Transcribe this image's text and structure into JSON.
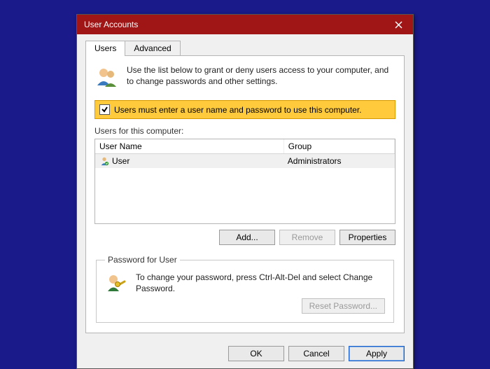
{
  "window": {
    "title": "User Accounts"
  },
  "tabs": {
    "users": "Users",
    "advanced": "Advanced"
  },
  "intro": "Use the list below to grant or deny users access to your computer, and to change passwords and other settings.",
  "checkbox_label": "Users must enter a user name and password to use this computer.",
  "list_label": "Users for this computer:",
  "columns": {
    "user": "User Name",
    "group": "Group"
  },
  "rows": [
    {
      "user": "User",
      "group": "Administrators"
    }
  ],
  "buttons": {
    "add": "Add...",
    "remove": "Remove",
    "properties": "Properties",
    "reset": "Reset Password...",
    "ok": "OK",
    "cancel": "Cancel",
    "apply": "Apply"
  },
  "password_group": {
    "legend": "Password for User",
    "text": "To change your password, press Ctrl-Alt-Del and select Change Password."
  }
}
